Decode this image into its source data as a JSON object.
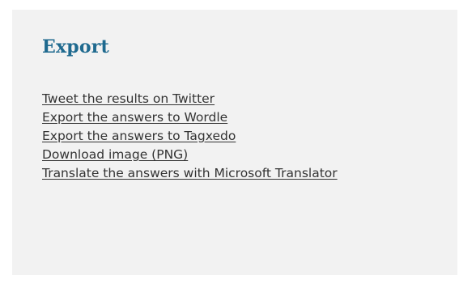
{
  "export_panel": {
    "title": "Export",
    "links": [
      "Tweet the results on Twitter",
      "Export the answers to Wordle",
      "Export the answers to Tagxedo",
      "Download image (PNG)",
      "Translate the answers with Microsoft Translator"
    ]
  },
  "colors": {
    "title": "#1f6a8f",
    "link_text": "#333333",
    "panel_background": "#f2f2f2"
  }
}
